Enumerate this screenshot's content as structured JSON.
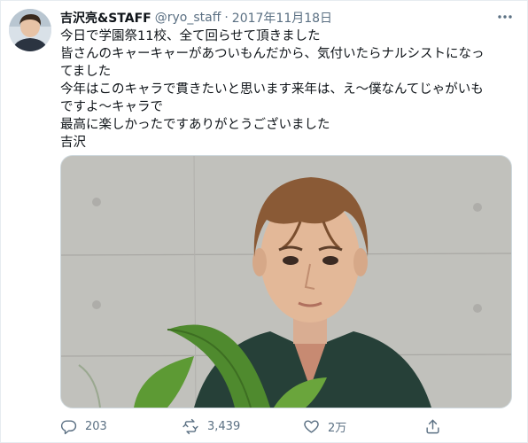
{
  "tweet": {
    "display_name": "吉沢亮&STAFF",
    "handle": "@ryo_staff",
    "separator": "·",
    "date": "2017年11月18日",
    "more_icon": "more-horizontal-icon",
    "body_lines": [
      "今日で学園祭11校、全て回らせて頂きました",
      "皆さんのキャーキャーがあついもんだから、気付いたらナルシストになっ",
      "てました",
      "今年はこのキャラで貫きたいと思います来年は、え〜僕なんてじゃがいも",
      "ですよ〜キャラで",
      "最高に楽しかったですありがとうございました",
      "吉沢"
    ],
    "media": {
      "type": "photo"
    }
  },
  "actions": {
    "reply": {
      "icon": "reply-icon",
      "count": "203"
    },
    "retweet": {
      "icon": "retweet-icon",
      "count": "3,439"
    },
    "like": {
      "icon": "heart-icon",
      "count": "2万"
    },
    "share": {
      "icon": "share-icon"
    }
  },
  "colors": {
    "text": "#0f1419",
    "secondary": "#5b7083",
    "border": "#e6ecf0"
  }
}
